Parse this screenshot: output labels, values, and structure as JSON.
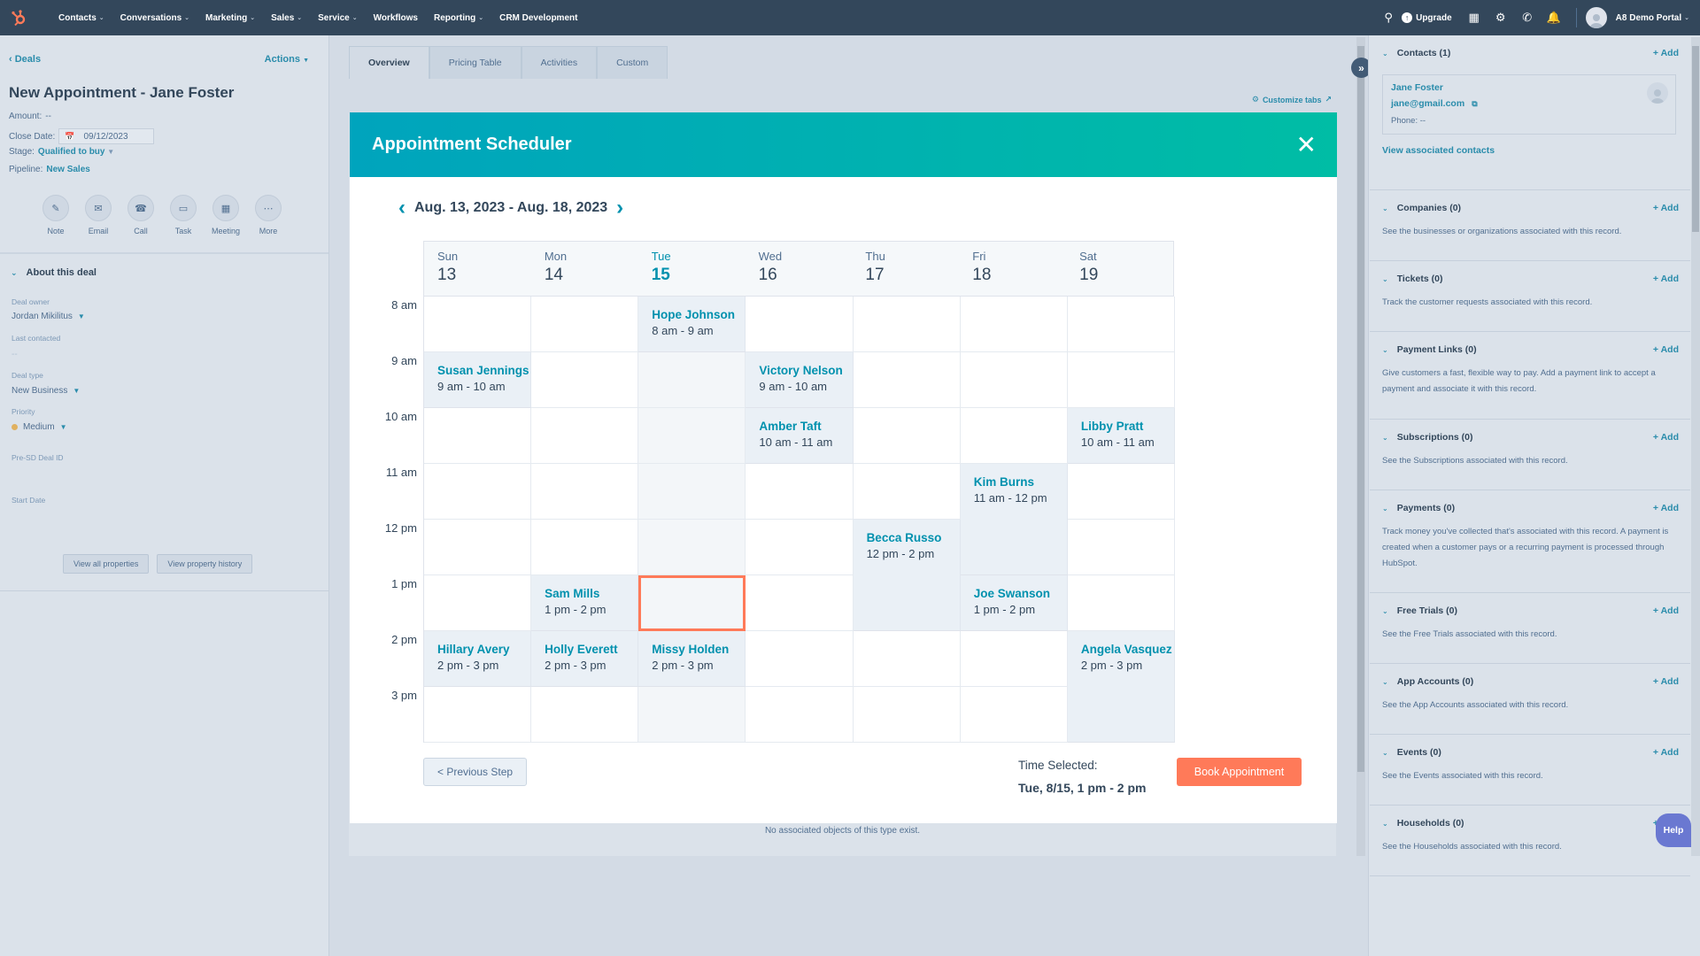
{
  "nav": {
    "items": [
      {
        "label": "Contacts",
        "dropdown": true
      },
      {
        "label": "Conversations",
        "dropdown": true
      },
      {
        "label": "Marketing",
        "dropdown": true
      },
      {
        "label": "Sales",
        "dropdown": true
      },
      {
        "label": "Service",
        "dropdown": true
      },
      {
        "label": "Workflows",
        "dropdown": false
      },
      {
        "label": "Reporting",
        "dropdown": true
      },
      {
        "label": "CRM Development",
        "dropdown": false
      }
    ],
    "upgrade_label": "Upgrade",
    "portal_label": "A8 Demo Portal",
    "icons": [
      "search-icon",
      "marketplace-icon",
      "gear-icon",
      "calling-icon",
      "bell-icon"
    ]
  },
  "deal": {
    "back_label": "Deals",
    "actions_label": "Actions",
    "title": "New Appointment - Jane Foster",
    "amount_label": "Amount:",
    "amount_value": "--",
    "close_date_label": "Close Date:",
    "close_date_value": "09/12/2023",
    "stage_label": "Stage:",
    "stage_value": "Qualified to buy",
    "pipeline_label": "Pipeline:",
    "pipeline_value": "New Sales",
    "action_buttons": [
      {
        "label": "Note",
        "icon": "note-icon"
      },
      {
        "label": "Email",
        "icon": "email-icon"
      },
      {
        "label": "Call",
        "icon": "phone-icon"
      },
      {
        "label": "Task",
        "icon": "task-icon"
      },
      {
        "label": "Meeting",
        "icon": "meeting-icon"
      },
      {
        "label": "More",
        "icon": "more-icon"
      }
    ],
    "about_heading": "About this deal",
    "fields": [
      {
        "label": "Deal owner",
        "value": "Jordan Mikilitus"
      },
      {
        "label": "Last contacted",
        "value": "--"
      },
      {
        "label": "Deal type",
        "value": "New Business"
      },
      {
        "label": "Priority",
        "value": "Medium"
      },
      {
        "label": "Pre-SD Deal ID",
        "value": ""
      },
      {
        "label": "Start Date",
        "value": ""
      }
    ],
    "view_all_label": "View all properties",
    "view_history_label": "View property history"
  },
  "tabs": [
    {
      "label": "Overview",
      "active": true
    },
    {
      "label": "Pricing Table",
      "active": false
    },
    {
      "label": "Activities",
      "active": false
    },
    {
      "label": "Custom",
      "active": false
    }
  ],
  "customize_tabs_label": "Customize tabs",
  "no_assoc_text": "No associated objects of this type exist.",
  "scheduler": {
    "title": "Appointment Scheduler",
    "week_range": "Aug. 13, 2023 - Aug. 18, 2023",
    "days": [
      {
        "name": "Sun",
        "num": "13",
        "today": false
      },
      {
        "name": "Mon",
        "num": "14",
        "today": false
      },
      {
        "name": "Tue",
        "num": "15",
        "today": true
      },
      {
        "name": "Wed",
        "num": "16",
        "today": false
      },
      {
        "name": "Thu",
        "num": "17",
        "today": false
      },
      {
        "name": "Fri",
        "num": "18",
        "today": false
      },
      {
        "name": "Sat",
        "num": "19",
        "today": false
      }
    ],
    "hours": [
      "8 am",
      "9 am",
      "10 am",
      "11 am",
      "12 pm",
      "1 pm",
      "2 pm",
      "3 pm"
    ],
    "events": [
      {
        "name": "Hope Johnson",
        "time": "8 am - 9 am",
        "day": 2,
        "start": 0,
        "span": 1
      },
      {
        "name": "Susan Jennings",
        "time": "9 am - 10 am",
        "day": 0,
        "start": 1,
        "span": 1
      },
      {
        "name": "Victory Nelson",
        "time": "9 am - 10 am",
        "day": 3,
        "start": 1,
        "span": 1
      },
      {
        "name": "Amber Taft",
        "time": "10 am - 11 am",
        "day": 3,
        "start": 2,
        "span": 1
      },
      {
        "name": "Libby Pratt",
        "time": "10 am - 11 am",
        "day": 6,
        "start": 2,
        "span": 1
      },
      {
        "name": "Kim Burns",
        "time": "11 am - 12 pm",
        "day": 5,
        "start": 3,
        "span": 2
      },
      {
        "name": "Becca Russo",
        "time": "12 pm - 2 pm",
        "day": 4,
        "start": 4,
        "span": 2
      },
      {
        "name": "Sam Mills",
        "time": "1 pm - 2 pm",
        "day": 1,
        "start": 5,
        "span": 1
      },
      {
        "name": "Joe Swanson",
        "time": "1 pm - 2 pm",
        "day": 5,
        "start": 5,
        "span": 1
      },
      {
        "name": "Hillary Avery",
        "time": "2 pm - 3 pm",
        "day": 0,
        "start": 6,
        "span": 1
      },
      {
        "name": "Holly Everett",
        "time": "2 pm - 3 pm",
        "day": 1,
        "start": 6,
        "span": 1
      },
      {
        "name": "Missy Holden",
        "time": "2 pm - 3 pm",
        "day": 2,
        "start": 6,
        "span": 1
      },
      {
        "name": "Angela Vasquez",
        "time": "2 pm - 3 pm",
        "day": 6,
        "start": 6,
        "span": 2
      }
    ],
    "selected_slot": {
      "day": 2,
      "start": 5
    },
    "prev_step_label": "< Previous Step",
    "time_selected_label": "Time Selected:",
    "time_selected_value": "Tue, 8/15, 1 pm - 2 pm",
    "book_label": "Book Appointment",
    "accent_color": "#0091ae",
    "book_color": "#ff7a59"
  },
  "right": {
    "add_label": "+ Add",
    "contacts": {
      "title": "Contacts (1)",
      "name": "Jane Foster",
      "email": "jane@gmail.com",
      "phone": "Phone: --",
      "view_link": "View associated contacts"
    },
    "sections": [
      {
        "title": "Companies (0)",
        "desc": "See the businesses or organizations associated with this record."
      },
      {
        "title": "Tickets (0)",
        "desc": "Track the customer requests associated with this record."
      },
      {
        "title": "Payment Links (0)",
        "desc": "Give customers a fast, flexible way to pay. Add a payment link to accept a payment and associate it with this record."
      },
      {
        "title": "Subscriptions (0)",
        "desc": "See the Subscriptions associated with this record."
      },
      {
        "title": "Payments (0)",
        "desc": "Track money you've collected that's associated with this record. A payment is created when a customer pays or a recurring payment is processed through HubSpot."
      },
      {
        "title": "Free Trials (0)",
        "desc": "See the Free Trials associated with this record."
      },
      {
        "title": "App Accounts (0)",
        "desc": "See the App Accounts associated with this record."
      },
      {
        "title": "Events (0)",
        "desc": "See the Events associated with this record."
      },
      {
        "title": "Households (0)",
        "desc": "See the Households associated with this record."
      }
    ],
    "help_label": "Help"
  }
}
